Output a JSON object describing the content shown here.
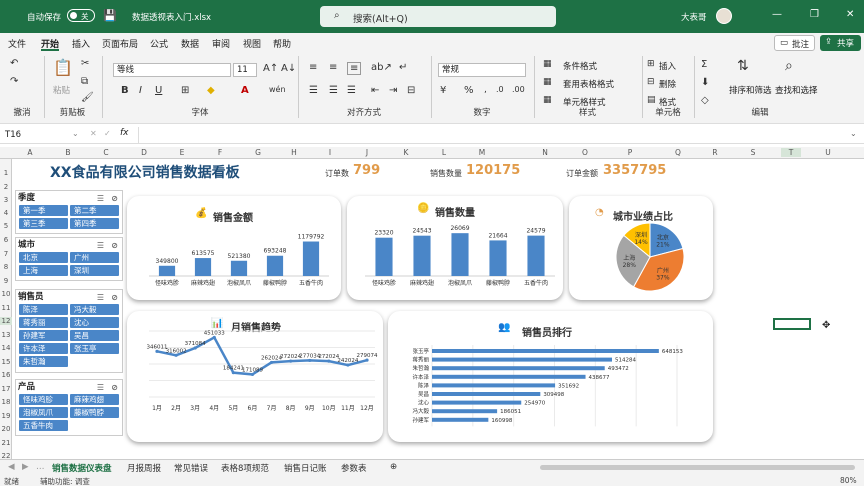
{
  "titlebar": {
    "autosave_label": "自动保存",
    "autosave_state": "关",
    "filename": "数据透视表入门.xlsx",
    "search_placeholder": "搜索(Alt+Q)",
    "user": "大表哥"
  },
  "menu": [
    "文件",
    "开始",
    "插入",
    "页面布局",
    "公式",
    "数据",
    "审阅",
    "视图",
    "帮助"
  ],
  "menu_right": {
    "comments": "批注",
    "share": "共享"
  },
  "ribbon": {
    "groups": [
      "撤消",
      "剪贴板",
      "字体",
      "对齐方式",
      "数字",
      "样式",
      "单元格",
      "编辑"
    ],
    "paste": "粘贴",
    "font_name": "等线",
    "font_size": "11",
    "number_format": "常规",
    "styles": [
      "条件格式",
      "套用表格格式",
      "单元格样式"
    ],
    "cells": [
      "插入",
      "删除",
      "格式"
    ],
    "edit": [
      "排序和筛选",
      "查找和选择"
    ]
  },
  "formula": {
    "namebox": "T16",
    "fx": "fx"
  },
  "columns": [
    "A",
    "B",
    "C",
    "D",
    "E",
    "F",
    "G",
    "H",
    "I",
    "J",
    "K",
    "L",
    "M",
    "N",
    "O",
    "P",
    "Q",
    "R",
    "S",
    "T",
    "U"
  ],
  "rows": [
    "1",
    "2",
    "3",
    "4",
    "5",
    "6",
    "7",
    "8",
    "9",
    "10",
    "11",
    "12",
    "13",
    "14",
    "15",
    "16",
    "17",
    "18",
    "19",
    "20",
    "21",
    "22"
  ],
  "dashboard": {
    "title": "XX食品有限公司销售数据看板",
    "kpis": [
      {
        "label": "订单数",
        "value": "799"
      },
      {
        "label": "销售数量",
        "value": "120175"
      },
      {
        "label": "订单金额",
        "value": "3357795"
      }
    ]
  },
  "slicers": [
    {
      "title": "季度",
      "items": [
        "第一季",
        "第二季",
        "第三季",
        "第四季"
      ]
    },
    {
      "title": "城市",
      "items": [
        "北京",
        "广州",
        "上海",
        "深圳"
      ]
    },
    {
      "title": "销售员",
      "items": [
        "陈泽",
        "冯大毅",
        "蒋秀丽",
        "沈心",
        "孙建军",
        "吴昌",
        "许本泽",
        "张玉亭",
        "朱哲瀚"
      ]
    },
    {
      "title": "产品",
      "items": [
        "怪味鸡胗",
        "麻辣鸡翅",
        "泡椒凤爪",
        "藤椒鸭脖",
        "五香牛肉"
      ]
    }
  ],
  "chart_titles": {
    "amount": "销售金额",
    "quantity": "销售数量",
    "city": "城市业绩占比",
    "monthly": "月销售趋势",
    "rank": "销售员排行"
  },
  "chart_data": [
    {
      "type": "bar",
      "title": "销售金额",
      "categories": [
        "怪味鸡胗",
        "麻辣鸡翅",
        "泡椒凤爪",
        "藤椒鸭脖",
        "五香牛肉"
      ],
      "values": [
        349800,
        613575,
        521380,
        693248,
        1179792
      ],
      "ylim": [
        0,
        1300000
      ],
      "color": "#4a86c8"
    },
    {
      "type": "bar",
      "title": "销售数量",
      "categories": [
        "怪味鸡胗",
        "麻辣鸡翅",
        "泡椒凤爪",
        "藤椒鸭脖",
        "五香牛肉"
      ],
      "values": [
        23320,
        24543,
        26069,
        21664,
        24579
      ],
      "ylim": [
        0,
        28000
      ],
      "color": "#4a86c8"
    },
    {
      "type": "pie",
      "title": "城市业绩占比",
      "categories": [
        "北京",
        "广州",
        "上海",
        "深圳"
      ],
      "values": [
        21,
        37,
        28,
        14
      ],
      "labels": [
        "北京\n21%",
        "广州\n37%",
        "上海\n28%",
        "深圳\n14%"
      ],
      "colors": [
        "#4a86c8",
        "#ed7d31",
        "#a5a5a5",
        "#ffc000"
      ]
    },
    {
      "type": "line",
      "title": "月销售趋势",
      "categories": [
        "1月",
        "2月",
        "3月",
        "4月",
        "5月",
        "6月",
        "7月",
        "8月",
        "9月",
        "10月",
        "11月",
        "12月"
      ],
      "values": [
        346011,
        316002,
        371084,
        451033,
        184241,
        171089,
        262024,
        272024,
        277034,
        272024,
        242024,
        279074
      ],
      "labels": [
        "346011",
        "316002",
        "371084",
        "451033",
        "184241",
        "171089",
        "262024",
        "272024",
        "277034",
        "272024",
        "242024",
        "279074"
      ],
      "ylim": [
        0,
        500000
      ],
      "color": "#4a86c8"
    },
    {
      "type": "bar",
      "orientation": "horizontal",
      "title": "销售员排行",
      "categories": [
        "张玉亭",
        "蒋秀丽",
        "朱哲瀚",
        "许本泽",
        "陈泽",
        "吴昌",
        "沈心",
        "冯大毅",
        "孙建军"
      ],
      "values": [
        648153,
        514284,
        493472,
        438677,
        351692,
        309498,
        254970,
        186051,
        160998
      ],
      "xlim": [
        0,
        700000
      ],
      "color": "#4a86c8"
    }
  ],
  "sheets": [
    "销售数据仪表盘",
    "月报周报",
    "常见错误",
    "表格8项规范",
    "销售日记账",
    "参数表"
  ],
  "statusbar": {
    "ready": "就绪",
    "accessibility": "辅助功能: 调查",
    "zoom": "80%"
  }
}
